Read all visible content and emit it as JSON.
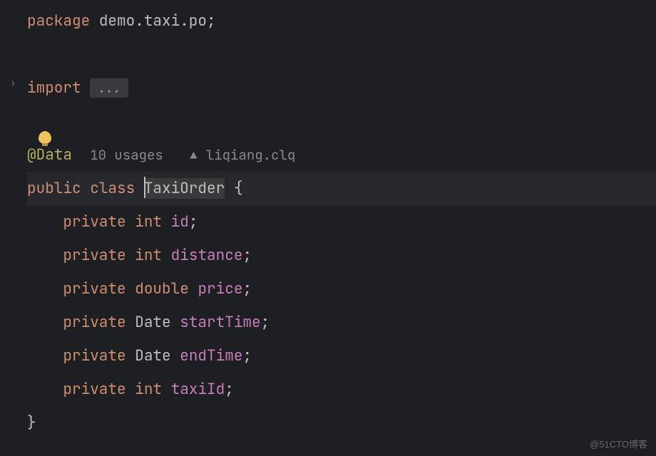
{
  "code": {
    "package_keyword": "package",
    "package_path": "demo.taxi.po",
    "import_keyword": "import",
    "import_folded": "...",
    "annotation": "@Data",
    "usages_hint": "10 usages",
    "author_hint": "liqiang.clq",
    "modifiers": {
      "public": "public",
      "private": "private",
      "class": "class"
    },
    "class_name": "TaxiOrder",
    "types": {
      "int": "int",
      "double": "double",
      "date": "Date"
    },
    "fields": {
      "id": "id",
      "distance": "distance",
      "price": "price",
      "startTime": "startTime",
      "endTime": "endTime",
      "taxiId": "taxiId"
    },
    "braces": {
      "open": "{",
      "close": "}"
    },
    "semicolon": ";"
  },
  "watermark": "@51CTO博客"
}
